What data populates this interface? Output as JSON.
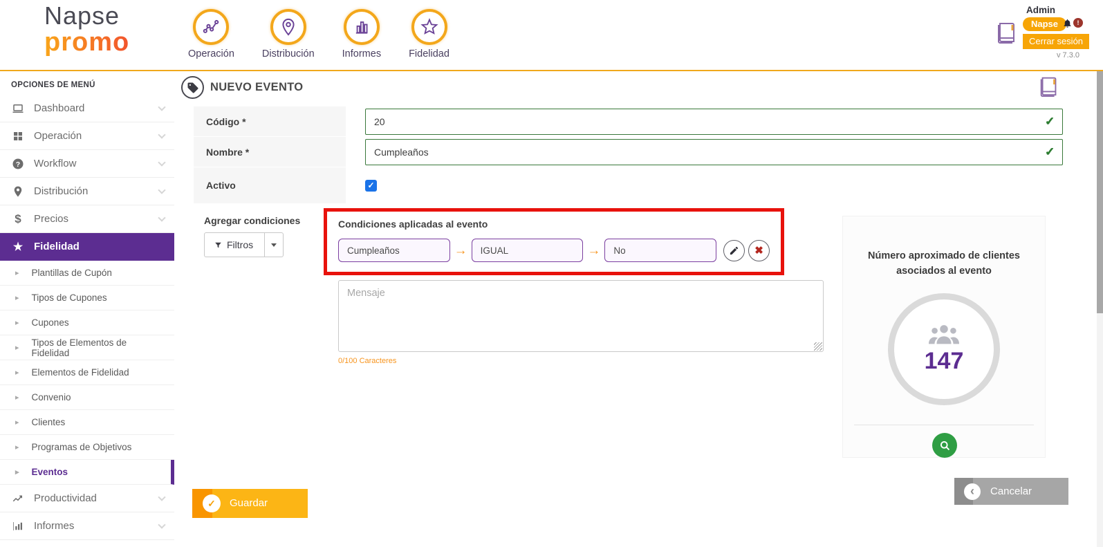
{
  "header": {
    "logo": {
      "top": "Napse",
      "bottom": "promo"
    },
    "nav_items": [
      {
        "label": "Operación",
        "icon": "scatter-chart-icon"
      },
      {
        "label": "Distribución",
        "icon": "location-pin-icon"
      },
      {
        "label": "Informes",
        "icon": "bar-chart-icon"
      },
      {
        "label": "Fidelidad",
        "icon": "star-icon"
      }
    ],
    "user": {
      "name": "Admin",
      "badge": "Napse",
      "alert": "!",
      "logout_label": "Cerrar sesión",
      "version": "v 7.3.0"
    }
  },
  "sidebar": {
    "title": "OPCIONES DE MENÚ",
    "items": [
      {
        "label": "Dashboard",
        "icon": "laptop-icon"
      },
      {
        "label": "Operación",
        "icon": "grid-icon"
      },
      {
        "label": "Workflow",
        "icon": "help-circle-icon"
      },
      {
        "label": "Distribución",
        "icon": "location-pin-icon"
      },
      {
        "label": "Precios",
        "icon": "dollar-icon"
      }
    ],
    "active_item": {
      "label": "Fidelidad",
      "icon": "star-icon"
    },
    "sub_items": [
      {
        "label": "Plantillas de Cupón"
      },
      {
        "label": "Tipos de Cupones"
      },
      {
        "label": "Cupones"
      },
      {
        "label": "Tipos de Elementos de Fidelidad"
      },
      {
        "label": "Elementos de Fidelidad"
      },
      {
        "label": "Convenio"
      },
      {
        "label": "Clientes"
      },
      {
        "label": "Programas de Objetivos"
      },
      {
        "label": "Eventos"
      }
    ],
    "selected_sub_item": "Eventos",
    "bottom_items": [
      {
        "label": "Productividad",
        "icon": "trend-line-icon"
      },
      {
        "label": "Informes",
        "icon": "bar-chart-icon"
      }
    ]
  },
  "main": {
    "title": "NUEVO EVENTO",
    "form": {
      "codigo_label": "Código *",
      "codigo_value": "20",
      "nombre_label": "Nombre *",
      "nombre_value": "Cumpleaños",
      "activo_label": "Activo",
      "activo_checked": true,
      "check_glyph": "✓"
    },
    "conditions": {
      "add_label": "Agregar condiciones",
      "filter_button_label": "Filtros",
      "applied_title": "Condiciones aplicadas al evento",
      "field": "Cumpleaños",
      "operator": "IGUAL",
      "value": "No",
      "arrow_glyph": "→",
      "delete_glyph": "✖"
    },
    "message": {
      "placeholder": "Mensaje",
      "counter": "0/100 Caracteres"
    },
    "client_panel": {
      "title": "Número aproximado de clientes asociados al evento",
      "count": "147"
    },
    "save_label": "Guardar",
    "save_check_glyph": "✓",
    "cancel_label": "Cancelar",
    "cancel_arrow_glyph": "‹"
  },
  "colors": {
    "accent_purple": "#5c2d91",
    "accent_orange": "#f7a506",
    "header_line_orange": "#f0a81c",
    "success_green": "#2e7d32",
    "input_border_green": "#39783a",
    "highlight_red": "#e8120c",
    "checkbox_blue": "#1a73e8",
    "save_amber": "#fcb515",
    "cancel_gray": "#a6a6a6",
    "count_purple": "#5c2d91",
    "search_green": "#2f9e44",
    "counter_orange": "#f7941d"
  }
}
